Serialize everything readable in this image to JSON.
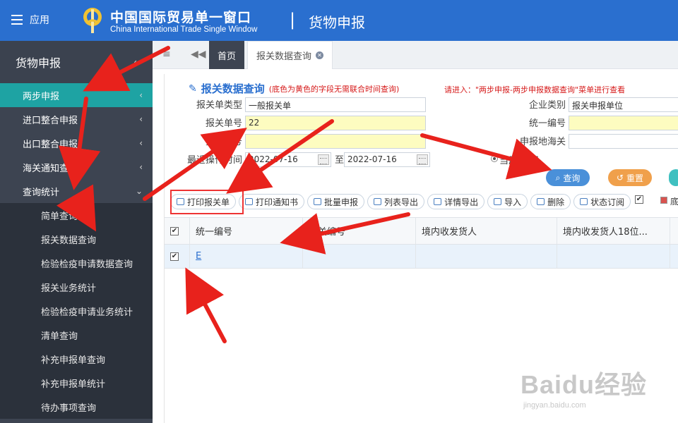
{
  "header": {
    "menu_label": "应用",
    "brand_cn": "中国国际贸易单一窗口",
    "brand_en": "China International Trade Single Window",
    "separator": "|",
    "module_title": "货物申报"
  },
  "sidebar": {
    "title": "货物申报",
    "items": [
      {
        "label": "两步申报",
        "active": true
      },
      {
        "label": "进口整合申报"
      },
      {
        "label": "出口整合申报"
      },
      {
        "label": "海关通知查询"
      },
      {
        "label": "查询统计",
        "expanded": true
      }
    ],
    "subitems": [
      "简单查询",
      "报关数据查询",
      "检验检疫申请数据查询",
      "报关业务统计",
      "检验检疫申请业务统计",
      "清单查询",
      "补充申报单查询",
      "补充申报单统计",
      "待办事项查询"
    ]
  },
  "tabs": {
    "home": "首页",
    "current": "报关数据查询"
  },
  "form": {
    "title": "报关数据查询",
    "title_note": "(底色为黄色的字段无需联合时间查询)",
    "hint": "请进入：\"两步申报-两步申报数据查询\"菜单进行查看",
    "labels": {
      "type": "报关单类型",
      "number": "报关单号",
      "bill": "提运单号",
      "time": "最近操作时间",
      "to": "至",
      "company_type": "企业类别",
      "unified_no": "统一编号",
      "customs": "申报地海关",
      "period": "当周 本周"
    },
    "values": {
      "type": "一般报关单",
      "number": "22",
      "date_from": "2022-07-16",
      "date_to": "2022-07-16",
      "company_type": "报关申报单位"
    },
    "buttons": {
      "search": "查询",
      "reset": "重置"
    }
  },
  "toolbar": [
    "打印报关单",
    "打印通知书",
    "批量申报",
    "列表导出",
    "详情导出",
    "导入",
    "删除",
    "状态订阅"
  ],
  "legend_text": "底",
  "table": {
    "headers": [
      "统一编号",
      "海关编号",
      "境内收发货人",
      "境内收发货人18位..."
    ],
    "rows": [
      {
        "unified_no": "E"
      }
    ]
  },
  "watermark": {
    "main": "Baidu经验",
    "sub": "jingyan.baidu.com"
  },
  "colors": {
    "header_bg": "#2a6fcf",
    "sidebar_bg": "#3d4451",
    "active_item": "#1ea3a3",
    "required_field": "#fdfcc0"
  }
}
